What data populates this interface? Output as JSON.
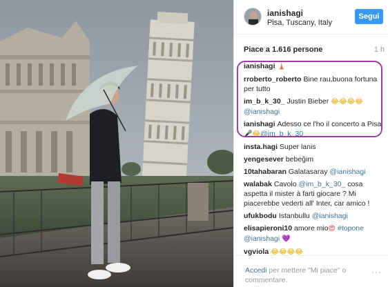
{
  "post": {
    "username": "ianishagi",
    "location": "Pisa, Tuscany, Italy",
    "follow_label": "Segui",
    "likes": "Piace a 1.616 persone",
    "time": "1 h"
  },
  "comments": [
    {
      "user": "ianishagi",
      "parts": [
        {
          "t": "🗼",
          "k": "emo-p"
        }
      ]
    },
    {
      "user": "rroberto_roberto",
      "parts": [
        {
          "t": "Bine rau,buona fortuna per tutto",
          "k": "text"
        }
      ]
    },
    {
      "user": "im_b_k_30_",
      "parts": [
        {
          "t": "Justin Bieber ",
          "k": "text"
        },
        {
          "t": "😂😂😂😂",
          "k": "emo-y"
        },
        {
          "t": " ",
          "k": "text"
        },
        {
          "t": "@ianishagi",
          "k": "mention"
        }
      ]
    },
    {
      "user": "ianishagi",
      "parts": [
        {
          "t": "Adesso ce l'ho il concerto a Pisa ",
          "k": "text"
        },
        {
          "t": "🎤😂",
          "k": "emo-y"
        },
        {
          "t": "@im_b_k_30_",
          "k": "mention"
        }
      ]
    },
    {
      "user": "insta.hagi",
      "parts": [
        {
          "t": "Super lanis",
          "k": "text"
        }
      ]
    },
    {
      "user": "yengesever",
      "parts": [
        {
          "t": "bebeğim",
          "k": "text"
        }
      ]
    },
    {
      "user": "10tahabaran",
      "parts": [
        {
          "t": "Galatasaray ",
          "k": "text"
        },
        {
          "t": "@ianishagi",
          "k": "mention"
        }
      ]
    },
    {
      "user": "walabak",
      "parts": [
        {
          "t": "Cavolo ",
          "k": "text"
        },
        {
          "t": "@im_b_k_30_",
          "k": "mention"
        },
        {
          "t": " cosa aspetta il mister à farti giocare ? Mi piacerebbe vederti all' Inter, car amico !",
          "k": "text"
        }
      ]
    },
    {
      "user": "ufukbodu",
      "parts": [
        {
          "t": "Istanbullu ",
          "k": "text"
        },
        {
          "t": "@ianishagi",
          "k": "mention"
        }
      ]
    },
    {
      "user": "elisapieroni10",
      "parts": [
        {
          "t": "amore mio",
          "k": "text"
        },
        {
          "t": "😍",
          "k": "emo-r"
        },
        {
          "t": " ",
          "k": "text"
        },
        {
          "t": "#topone",
          "k": "tag"
        },
        {
          "t": " ",
          "k": "text"
        },
        {
          "t": "@ianishagi",
          "k": "mention"
        },
        {
          "t": " ",
          "k": "text"
        },
        {
          "t": "💜",
          "k": "emo-p"
        }
      ]
    },
    {
      "user": "vgviola",
      "parts": [
        {
          "t": "😂😂😂😂",
          "k": "emo-y"
        }
      ]
    }
  ],
  "footer": {
    "login_label": "Accedi",
    "rest": " per mettere \"Mi piace\" o commentare.",
    "more_label": "···"
  },
  "colors": {
    "follow_button": "#3897f0",
    "highlight_border": "#9c3ea1",
    "mention": "#3f729b"
  }
}
